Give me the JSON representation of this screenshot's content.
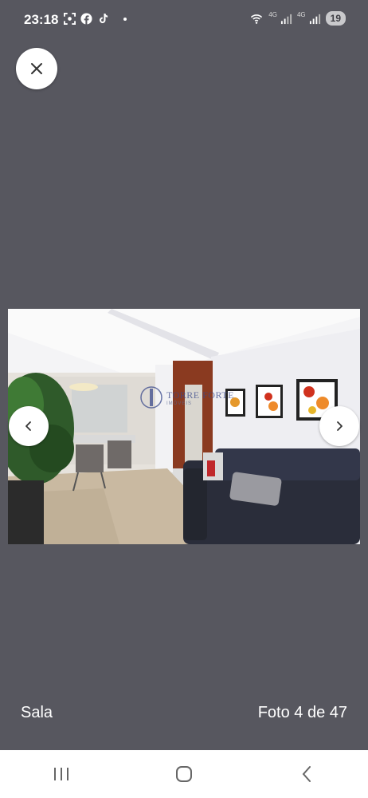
{
  "status_bar": {
    "time": "23:18",
    "left_icons": [
      "screenshot-icon",
      "facebook-icon",
      "tiktok-icon",
      "notification-dot"
    ],
    "network_label_1": "4G",
    "network_label_2": "4G",
    "battery_level": "19"
  },
  "viewer": {
    "close_icon": "close-icon",
    "prev_icon": "chevron-left-icon",
    "next_icon": "chevron-right-icon",
    "watermark_title": "TORRE FORTE",
    "watermark_subtitle": "IMÓVEIS",
    "photo_alt": "Sala"
  },
  "caption": {
    "room": "Sala",
    "counter": "Foto 4 de 47"
  },
  "system_nav": {
    "recents_icon": "recents-icon",
    "home_icon": "home-icon",
    "back_icon": "back-icon"
  },
  "colors": {
    "background": "#57575f",
    "button_bg": "#ffffff",
    "sofa": "#2a2d3a",
    "wall": "#f1f1f3"
  }
}
